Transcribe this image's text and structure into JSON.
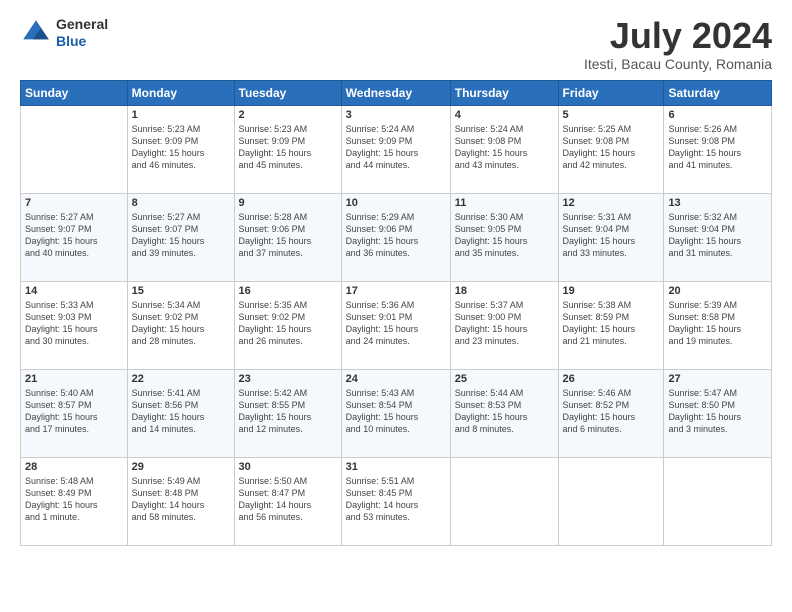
{
  "header": {
    "logo": {
      "line1": "General",
      "line2": "Blue"
    },
    "title": "July 2024",
    "location": "Itesti, Bacau County, Romania"
  },
  "weekdays": [
    "Sunday",
    "Monday",
    "Tuesday",
    "Wednesday",
    "Thursday",
    "Friday",
    "Saturday"
  ],
  "weeks": [
    [
      {
        "day": "",
        "info": ""
      },
      {
        "day": "1",
        "info": "Sunrise: 5:23 AM\nSunset: 9:09 PM\nDaylight: 15 hours\nand 46 minutes."
      },
      {
        "day": "2",
        "info": "Sunrise: 5:23 AM\nSunset: 9:09 PM\nDaylight: 15 hours\nand 45 minutes."
      },
      {
        "day": "3",
        "info": "Sunrise: 5:24 AM\nSunset: 9:09 PM\nDaylight: 15 hours\nand 44 minutes."
      },
      {
        "day": "4",
        "info": "Sunrise: 5:24 AM\nSunset: 9:08 PM\nDaylight: 15 hours\nand 43 minutes."
      },
      {
        "day": "5",
        "info": "Sunrise: 5:25 AM\nSunset: 9:08 PM\nDaylight: 15 hours\nand 42 minutes."
      },
      {
        "day": "6",
        "info": "Sunrise: 5:26 AM\nSunset: 9:08 PM\nDaylight: 15 hours\nand 41 minutes."
      }
    ],
    [
      {
        "day": "7",
        "info": "Sunrise: 5:27 AM\nSunset: 9:07 PM\nDaylight: 15 hours\nand 40 minutes."
      },
      {
        "day": "8",
        "info": "Sunrise: 5:27 AM\nSunset: 9:07 PM\nDaylight: 15 hours\nand 39 minutes."
      },
      {
        "day": "9",
        "info": "Sunrise: 5:28 AM\nSunset: 9:06 PM\nDaylight: 15 hours\nand 37 minutes."
      },
      {
        "day": "10",
        "info": "Sunrise: 5:29 AM\nSunset: 9:06 PM\nDaylight: 15 hours\nand 36 minutes."
      },
      {
        "day": "11",
        "info": "Sunrise: 5:30 AM\nSunset: 9:05 PM\nDaylight: 15 hours\nand 35 minutes."
      },
      {
        "day": "12",
        "info": "Sunrise: 5:31 AM\nSunset: 9:04 PM\nDaylight: 15 hours\nand 33 minutes."
      },
      {
        "day": "13",
        "info": "Sunrise: 5:32 AM\nSunset: 9:04 PM\nDaylight: 15 hours\nand 31 minutes."
      }
    ],
    [
      {
        "day": "14",
        "info": "Sunrise: 5:33 AM\nSunset: 9:03 PM\nDaylight: 15 hours\nand 30 minutes."
      },
      {
        "day": "15",
        "info": "Sunrise: 5:34 AM\nSunset: 9:02 PM\nDaylight: 15 hours\nand 28 minutes."
      },
      {
        "day": "16",
        "info": "Sunrise: 5:35 AM\nSunset: 9:02 PM\nDaylight: 15 hours\nand 26 minutes."
      },
      {
        "day": "17",
        "info": "Sunrise: 5:36 AM\nSunset: 9:01 PM\nDaylight: 15 hours\nand 24 minutes."
      },
      {
        "day": "18",
        "info": "Sunrise: 5:37 AM\nSunset: 9:00 PM\nDaylight: 15 hours\nand 23 minutes."
      },
      {
        "day": "19",
        "info": "Sunrise: 5:38 AM\nSunset: 8:59 PM\nDaylight: 15 hours\nand 21 minutes."
      },
      {
        "day": "20",
        "info": "Sunrise: 5:39 AM\nSunset: 8:58 PM\nDaylight: 15 hours\nand 19 minutes."
      }
    ],
    [
      {
        "day": "21",
        "info": "Sunrise: 5:40 AM\nSunset: 8:57 PM\nDaylight: 15 hours\nand 17 minutes."
      },
      {
        "day": "22",
        "info": "Sunrise: 5:41 AM\nSunset: 8:56 PM\nDaylight: 15 hours\nand 14 minutes."
      },
      {
        "day": "23",
        "info": "Sunrise: 5:42 AM\nSunset: 8:55 PM\nDaylight: 15 hours\nand 12 minutes."
      },
      {
        "day": "24",
        "info": "Sunrise: 5:43 AM\nSunset: 8:54 PM\nDaylight: 15 hours\nand 10 minutes."
      },
      {
        "day": "25",
        "info": "Sunrise: 5:44 AM\nSunset: 8:53 PM\nDaylight: 15 hours\nand 8 minutes."
      },
      {
        "day": "26",
        "info": "Sunrise: 5:46 AM\nSunset: 8:52 PM\nDaylight: 15 hours\nand 6 minutes."
      },
      {
        "day": "27",
        "info": "Sunrise: 5:47 AM\nSunset: 8:50 PM\nDaylight: 15 hours\nand 3 minutes."
      }
    ],
    [
      {
        "day": "28",
        "info": "Sunrise: 5:48 AM\nSunset: 8:49 PM\nDaylight: 15 hours\nand 1 minute."
      },
      {
        "day": "29",
        "info": "Sunrise: 5:49 AM\nSunset: 8:48 PM\nDaylight: 14 hours\nand 58 minutes."
      },
      {
        "day": "30",
        "info": "Sunrise: 5:50 AM\nSunset: 8:47 PM\nDaylight: 14 hours\nand 56 minutes."
      },
      {
        "day": "31",
        "info": "Sunrise: 5:51 AM\nSunset: 8:45 PM\nDaylight: 14 hours\nand 53 minutes."
      },
      {
        "day": "",
        "info": ""
      },
      {
        "day": "",
        "info": ""
      },
      {
        "day": "",
        "info": ""
      }
    ]
  ]
}
